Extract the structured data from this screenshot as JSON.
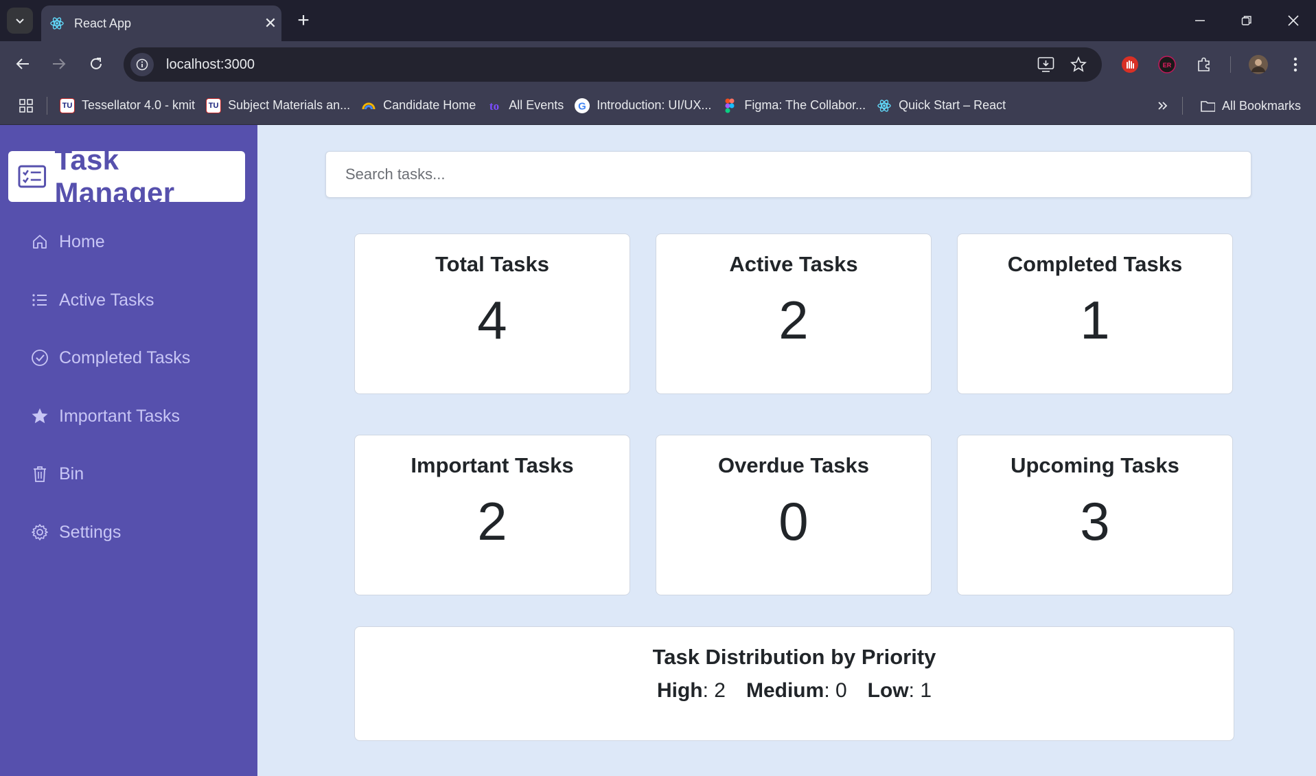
{
  "browser": {
    "tab_title": "React App",
    "url": "localhost:3000",
    "bookmarks": [
      {
        "label": "Tessellator 4.0 - kmit",
        "icon": "tu-logo-icon"
      },
      {
        "label": "Subject Materials an...",
        "icon": "tu-logo-icon"
      },
      {
        "label": "Candidate Home",
        "icon": "rainbow-icon"
      },
      {
        "label": "All Events",
        "icon": "events-icon"
      },
      {
        "label": "Introduction: UI/UX...",
        "icon": "google-icon"
      },
      {
        "label": "Figma: The Collabor...",
        "icon": "figma-icon"
      },
      {
        "label": "Quick Start – React",
        "icon": "react-icon"
      }
    ],
    "all_bookmarks_label": "All Bookmarks"
  },
  "app": {
    "logo_text": "Task Manager",
    "nav": [
      {
        "label": "Home",
        "icon": "home-icon"
      },
      {
        "label": "Active Tasks",
        "icon": "list-icon"
      },
      {
        "label": "Completed Tasks",
        "icon": "check-circle-icon"
      },
      {
        "label": "Important Tasks",
        "icon": "star-icon"
      },
      {
        "label": "Bin",
        "icon": "trash-icon"
      },
      {
        "label": "Settings",
        "icon": "gear-icon"
      }
    ],
    "search_placeholder": "Search tasks...",
    "stats": [
      {
        "title": "Total Tasks",
        "value": "4"
      },
      {
        "title": "Active Tasks",
        "value": "2"
      },
      {
        "title": "Completed Tasks",
        "value": "1"
      },
      {
        "title": "Important Tasks",
        "value": "2"
      },
      {
        "title": "Overdue Tasks",
        "value": "0"
      },
      {
        "title": "Upcoming Tasks",
        "value": "3"
      }
    ],
    "priority": {
      "title": "Task Distribution by Priority",
      "high_label": "High",
      "high_value": ": 2",
      "medium_label": "Medium",
      "medium_value": ": 0",
      "low_label": "Low",
      "low_value": ": 1"
    },
    "colors": {
      "sidebar": "#5650ad",
      "background": "#dde8f8",
      "nav_text": "#c8c6f5"
    }
  }
}
